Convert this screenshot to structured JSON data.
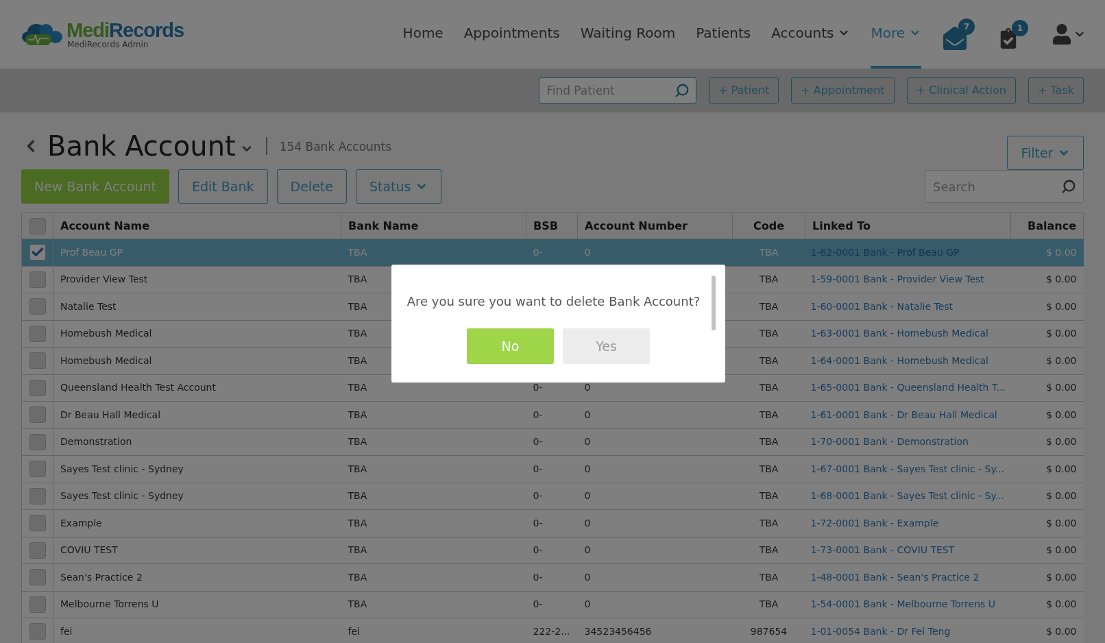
{
  "header": {
    "logo": {
      "first": "Medi",
      "second": "Records"
    },
    "logo_subtitle": "MediRecords Admin",
    "nav": [
      {
        "label": "Home",
        "selected": false,
        "dropdown": false
      },
      {
        "label": "Appointments",
        "selected": false,
        "dropdown": false
      },
      {
        "label": "Waiting Room",
        "selected": false,
        "dropdown": false
      },
      {
        "label": "Patients",
        "selected": false,
        "dropdown": false
      },
      {
        "label": "Accounts",
        "selected": false,
        "dropdown": true
      },
      {
        "label": "More",
        "selected": true,
        "dropdown": true
      }
    ],
    "messages_badge": "7",
    "tasks_badge": "1"
  },
  "toolbar": {
    "search": {
      "placeholder": "Find Patient"
    },
    "buttons": [
      "+ Patient",
      "+ Appointment",
      "+ Clinical Action",
      "+ Task"
    ]
  },
  "page": {
    "title": "Bank Account",
    "count": "154 Bank Accounts",
    "filter": "Filter",
    "actions": [
      {
        "label": "New Bank Account",
        "kind": "primary"
      },
      {
        "label": "Edit Bank",
        "kind": "outline"
      },
      {
        "label": "Delete",
        "kind": "outline"
      },
      {
        "label": "Status",
        "kind": "dropdown"
      }
    ],
    "search": {
      "placeholder": "Search"
    }
  },
  "table": {
    "select_all_checked": false,
    "columns": [
      "Account Name",
      "Bank Name",
      "BSB",
      "Account Number",
      "Code",
      "Linked To",
      "Balance"
    ],
    "rows": [
      {
        "selected": true,
        "account_name": "Prof Beau GP",
        "bank_name": "TBA",
        "bsb": "0-",
        "account_number": "0",
        "code": "TBA",
        "linked_to": "1-62-0001 Bank - Prof Beau GP",
        "balance": "$ 0.00"
      },
      {
        "selected": false,
        "account_name": "Provider View Test",
        "bank_name": "TBA",
        "code": "TBA",
        "linked_to": "1-59-0001 Bank - Provider View Test",
        "balance": "$ 0.00"
      },
      {
        "selected": false,
        "account_name": "Natalie Test",
        "bank_name": "TBA",
        "code": "TBA",
        "linked_to": "1-60-0001 Bank - Natalie Test",
        "balance": "$ 0.00"
      },
      {
        "selected": false,
        "account_name": "Homebush Medical",
        "bank_name": "TBA",
        "code": "TBA",
        "linked_to": "1-63-0001 Bank - Homebush Medical",
        "balance": "$ 0.00"
      },
      {
        "selected": false,
        "account_name": "Homebush Medical",
        "bank_name": "TBA",
        "code": "TBA",
        "linked_to": "1-64-0001 Bank - Homebush Medical",
        "balance": "$ 0.00"
      },
      {
        "selected": false,
        "account_name": "Queensland Health Test Account",
        "bank_name": "TBA",
        "bsb": "0-",
        "account_number": "0",
        "code": "TBA",
        "linked_to": "1-65-0001 Bank - Queensland Health T...",
        "balance": "$ 0.00"
      },
      {
        "selected": false,
        "account_name": "Dr Beau Hall Medical",
        "bank_name": "TBA",
        "bsb": "0-",
        "account_number": "0",
        "code": "TBA",
        "linked_to": "1-61-0001 Bank - Dr Beau Hall Medical",
        "balance": "$ 0.00"
      },
      {
        "selected": false,
        "account_name": "Demonstration",
        "bank_name": "TBA",
        "bsb": "0-",
        "account_number": "0",
        "code": "TBA",
        "linked_to": "1-70-0001 Bank - Demonstration",
        "balance": "$ 0.00"
      },
      {
        "selected": false,
        "account_name": "Sayes Test clinic - Sydney",
        "bank_name": "TBA",
        "bsb": "0-",
        "account_number": "0",
        "code": "TBA",
        "linked_to": "1-67-0001 Bank - Sayes Test clinic - Sy...",
        "balance": "$ 0.00"
      },
      {
        "selected": false,
        "account_name": "Sayes Test clinic - Sydney",
        "bank_name": "TBA",
        "bsb": "0-",
        "account_number": "0",
        "code": "TBA",
        "linked_to": "1-68-0001 Bank - Sayes Test clinic - Sy...",
        "balance": "$ 0.00"
      },
      {
        "selected": false,
        "account_name": "Example",
        "bank_name": "TBA",
        "bsb": "0-",
        "account_number": "0",
        "code": "TBA",
        "linked_to": "1-72-0001 Bank - Example",
        "balance": "$ 0.00"
      },
      {
        "selected": false,
        "account_name": "COVIU TEST",
        "bank_name": "TBA",
        "bsb": "0-",
        "account_number": "0",
        "code": "TBA",
        "linked_to": "1-73-0001 Bank - COVIU TEST",
        "balance": "$ 0.00"
      },
      {
        "selected": false,
        "account_name": "Sean's Practice 2",
        "bank_name": "TBA",
        "bsb": "0-",
        "account_number": "0",
        "code": "TBA",
        "linked_to": "1-48-0001 Bank - Sean's Practice 2",
        "balance": "$ 0.00"
      },
      {
        "selected": false,
        "account_name": "Melbourne Torrens U",
        "bank_name": "TBA",
        "bsb": "0-",
        "account_number": "0",
        "code": "TBA",
        "linked_to": "1-54-0001 Bank - Melbourne Torrens U",
        "balance": "$ 0.00"
      },
      {
        "selected": false,
        "account_name": "fei",
        "bank_name": "fei",
        "bsb": "222-2...",
        "account_number": "34523456456",
        "code": "987654",
        "linked_to": "1-01-0054 Bank - Dr Fei Teng",
        "balance": "$ 0.00"
      }
    ]
  },
  "dialog": {
    "message": "Are you sure you want to delete Bank Account?",
    "buttons": [
      {
        "label": "No",
        "kind": "primary"
      },
      {
        "label": "Yes",
        "kind": "secondary"
      }
    ]
  }
}
